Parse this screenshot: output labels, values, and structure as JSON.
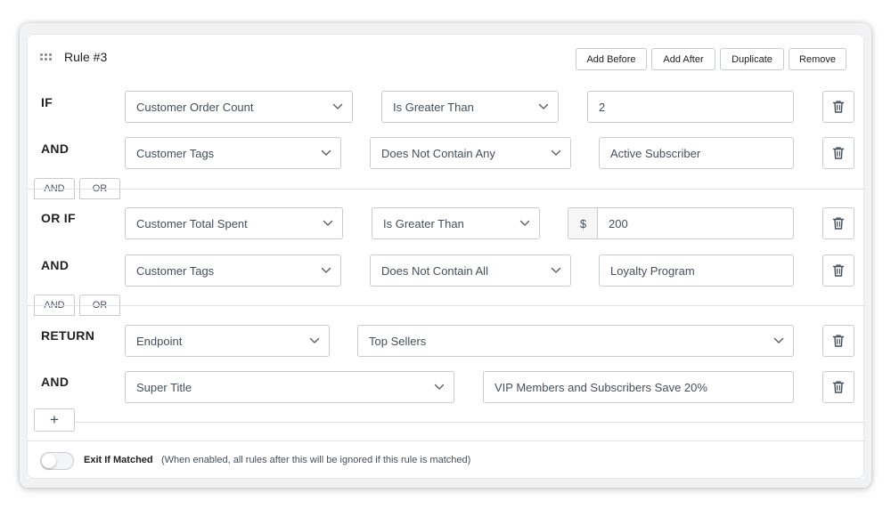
{
  "rule": {
    "title": "Rule #3",
    "actions": [
      "Add Before",
      "Add After",
      "Duplicate",
      "Remove"
    ]
  },
  "groups": [
    {
      "conditions": [
        {
          "keyword": "IF",
          "field": "Customer Order Count",
          "operator": "Is Greater Than",
          "value": "2"
        },
        {
          "keyword": "AND",
          "field": "Customer Tags",
          "operator": "Does Not Contain Any",
          "value": "Active Subscriber"
        }
      ],
      "connectors": [
        "AND",
        "OR"
      ]
    },
    {
      "conditions": [
        {
          "keyword": "OR IF",
          "field": "Customer Total Spent",
          "operator": "Is Greater Than",
          "prefix": "$",
          "value": "200"
        },
        {
          "keyword": "AND",
          "field": "Customer Tags",
          "operator": "Does Not Contain All",
          "value": "Loyalty Program"
        }
      ],
      "connectors": [
        "AND",
        "OR"
      ]
    }
  ],
  "return_block": {
    "rows": [
      {
        "keyword": "RETURN",
        "field": "Endpoint",
        "value": "Top Sellers"
      },
      {
        "keyword": "AND",
        "field": "Super Title",
        "value": "VIP Members and Subscribers Save 20%"
      }
    ],
    "add_label": "+"
  },
  "footer": {
    "toggle_on": false,
    "label": "Exit If Matched",
    "help": "(When enabled, all rules after this will be ignored if this rule is matched)"
  },
  "icons": {
    "drag": "drag-handle-icon",
    "chevron": "chevron-down-icon",
    "delete": "trash-icon"
  }
}
